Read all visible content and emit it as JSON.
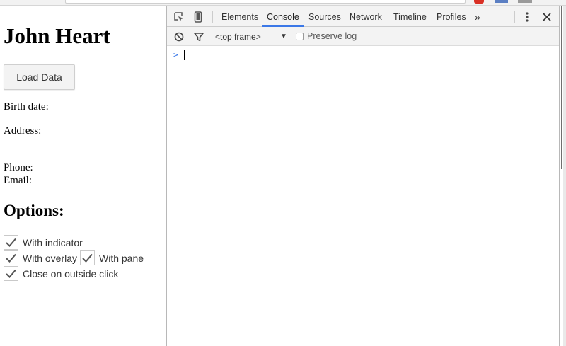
{
  "page": {
    "title": "John Heart",
    "load_button": "Load Data",
    "fields": {
      "birth_date": "Birth date:",
      "address": "Address:",
      "phone": "Phone:",
      "email": "Email:"
    },
    "options_heading": "Options:",
    "options": [
      {
        "label": "With indicator",
        "checked": true
      },
      {
        "label": "With overlay",
        "checked": true
      },
      {
        "label": "With pane",
        "checked": true
      },
      {
        "label": "Close on outside click",
        "checked": true
      }
    ]
  },
  "devtools": {
    "tabs": [
      "Elements",
      "Console",
      "Sources",
      "Network",
      "Timeline",
      "Profiles"
    ],
    "active_tab": "Console",
    "more_tabs": "»",
    "frame_select": "<top frame>",
    "frame_arrow": "▼",
    "preserve_log": "Preserve log",
    "preserve_checked": false,
    "prompt": ">",
    "accent_color": "#3b78e7"
  }
}
